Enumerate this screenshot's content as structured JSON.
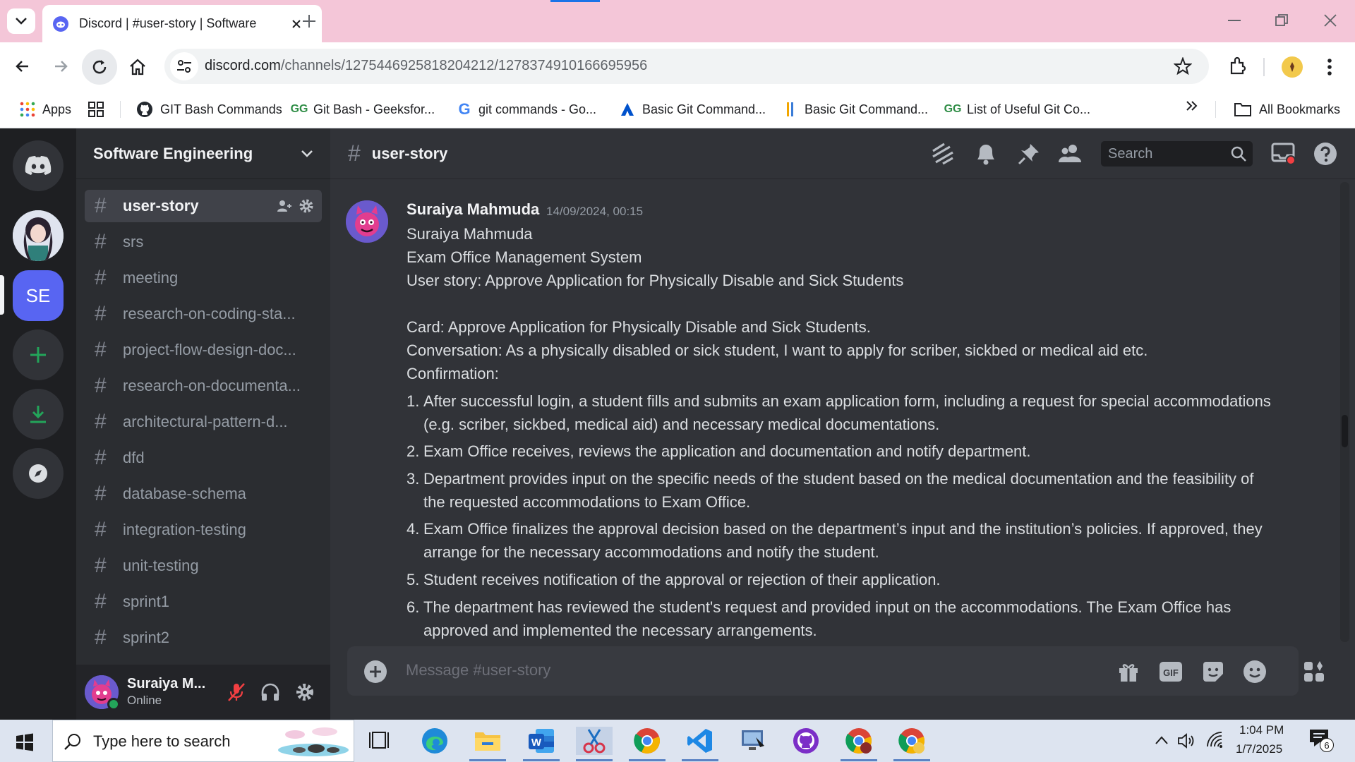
{
  "browser": {
    "tab_title": "Discord | #user-story | Software",
    "url_host": "discord.com",
    "url_path": "/channels/1275446925818204212/1278374910166695956",
    "bookmarks": [
      {
        "label": "Apps",
        "icon": "apps-grid-icon"
      },
      {
        "label": "",
        "icon": "grid-icon"
      },
      {
        "label": "GIT Bash Commands",
        "icon": "github-icon"
      },
      {
        "label": "Git Bash - Geeksfor...",
        "icon": "gfg-icon"
      },
      {
        "label": "git commands - Go...",
        "icon": "google-icon"
      },
      {
        "label": "Basic Git Command...",
        "icon": "atlassian-icon"
      },
      {
        "label": "Basic Git Command...",
        "icon": "bookmark-icon"
      },
      {
        "label": "List of Useful Git Co...",
        "icon": "gfg-icon"
      }
    ],
    "all_bookmarks": "All Bookmarks"
  },
  "discord": {
    "server_name": "Software Engineering",
    "server_initials": "SE",
    "channels": [
      "user-story",
      "srs",
      "meeting",
      "research-on-coding-sta...",
      "project-flow-design-doc...",
      "research-on-documenta...",
      "architectural-pattern-d...",
      "dfd",
      "database-schema",
      "integration-testing",
      "unit-testing",
      "sprint1",
      "sprint2"
    ],
    "active_channel": "user-story",
    "user": {
      "name": "Suraiya M...",
      "status": "Online"
    },
    "chat_header": "user-story",
    "search_placeholder": "Search",
    "composer_placeholder": "Message #user-story",
    "message": {
      "author": "Suraiya Mahmuda",
      "timestamp": "14/09/2024, 00:15",
      "lines": [
        "Suraiya Mahmuda",
        "Exam Office Management System",
        "User story: Approve Application for Physically Disable and Sick Students",
        "",
        "Card: Approve Application for Physically Disable and Sick Students.",
        "Conversation: As a physically disabled or sick student, I want to apply for scriber, sickbed or medical aid etc.",
        "Confirmation:"
      ],
      "list": [
        "After successful login, a student fills and submits an exam application form, including a request for special accommodations (e.g. scriber, sickbed, medical aid) and necessary medical documentations.",
        "Exam Office receives, reviews the application and documentation and notify department.",
        "Department provides input on the specific needs of the student based on the medical documentation and the feasibility of the requested accommodations to Exam Office.",
        "Exam Office finalizes the approval decision based on the department’s input and the institution’s policies. If approved, they arrange for the necessary accommodations and notify the student.",
        "Student receives notification of the approval or rejection of their application.",
        "The department has reviewed the student's request and provided input on the accommodations. The Exam Office has approved and implemented the necessary arrangements."
      ],
      "list_numbers": [
        "1.",
        "2.",
        "3.",
        "4.",
        "5.",
        "6."
      ]
    }
  },
  "taskbar": {
    "search_placeholder": "Type here to search",
    "time": "1:04 PM",
    "date": "1/7/2025",
    "notification_count": "6"
  },
  "colors": {
    "discord_blurple": "#5865f2",
    "discord_green": "#23a55a",
    "chrome_tab_strip": "#f4c6d8"
  }
}
